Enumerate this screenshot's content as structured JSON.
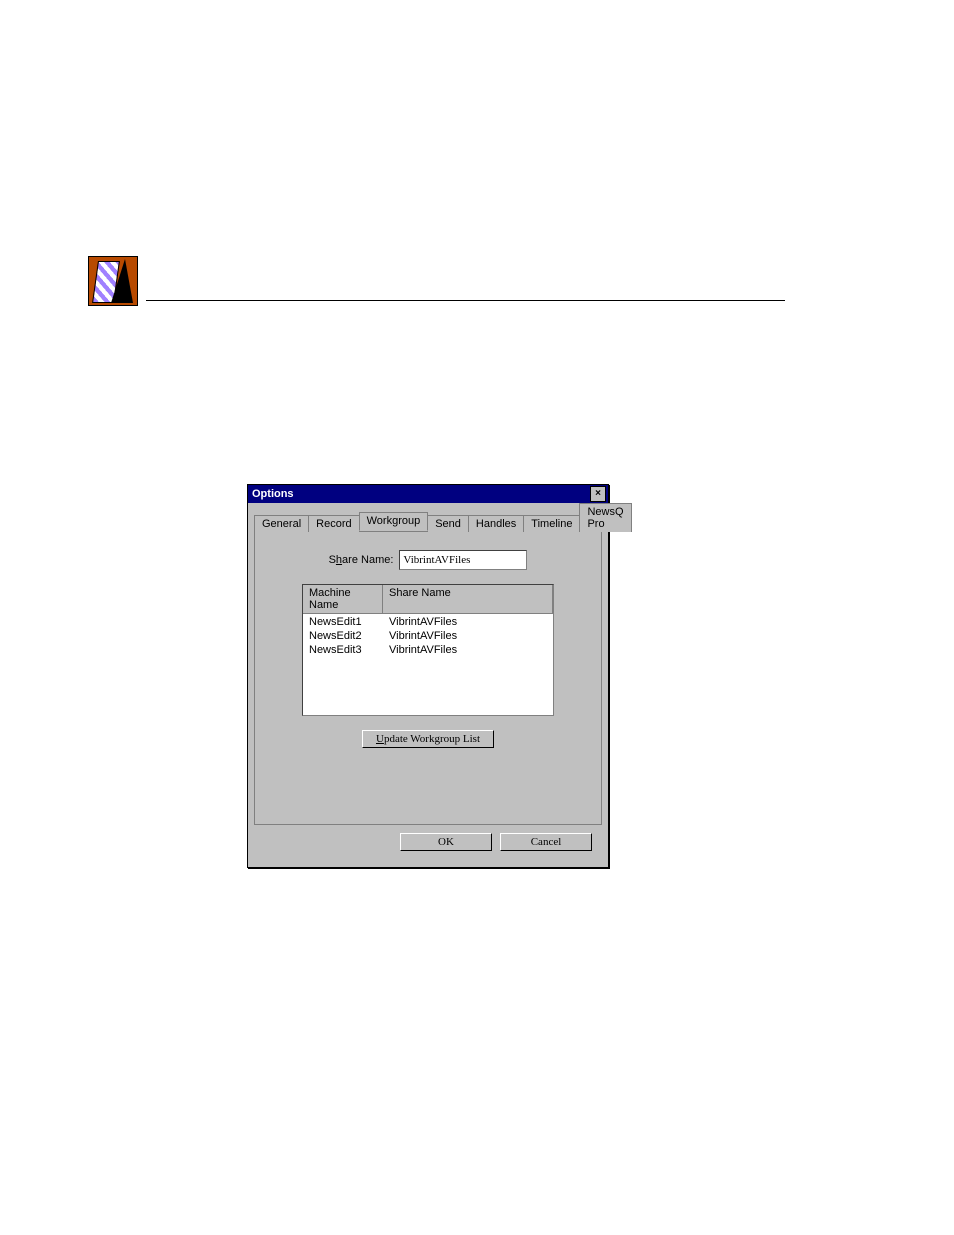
{
  "dialog": {
    "title": "Options",
    "close_glyph": "×",
    "tabs": [
      {
        "label": "General"
      },
      {
        "label": "Record"
      },
      {
        "label": "Workgroup",
        "active": true
      },
      {
        "label": "Send"
      },
      {
        "label": "Handles"
      },
      {
        "label": "Timeline"
      },
      {
        "label": "NewsQ Pro"
      }
    ],
    "share_label_pre": "S",
    "share_label_und": "h",
    "share_label_post": "are Name:",
    "share_value": "VibrintAVFiles",
    "list": {
      "col1": "Machine Name",
      "col2": "Share Name",
      "rows": [
        {
          "m": "NewsEdit1",
          "s": "VibrintAVFiles"
        },
        {
          "m": "NewsEdit2",
          "s": "VibrintAVFiles"
        },
        {
          "m": "NewsEdit3",
          "s": "VibrintAVFiles"
        }
      ]
    },
    "update_pre": "",
    "update_und": "U",
    "update_post": "pdate Workgroup List",
    "ok": "OK",
    "cancel": "Cancel"
  }
}
